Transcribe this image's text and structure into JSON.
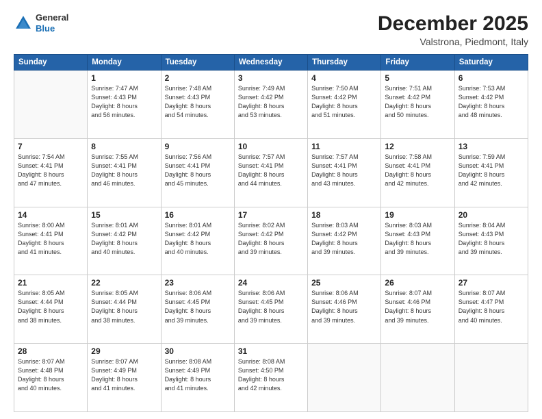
{
  "header": {
    "logo_line1": "General",
    "logo_line2": "Blue",
    "month_year": "December 2025",
    "location": "Valstrona, Piedmont, Italy"
  },
  "days_of_week": [
    "Sunday",
    "Monday",
    "Tuesday",
    "Wednesday",
    "Thursday",
    "Friday",
    "Saturday"
  ],
  "weeks": [
    [
      {
        "day": "",
        "info": ""
      },
      {
        "day": "1",
        "info": "Sunrise: 7:47 AM\nSunset: 4:43 PM\nDaylight: 8 hours\nand 56 minutes."
      },
      {
        "day": "2",
        "info": "Sunrise: 7:48 AM\nSunset: 4:43 PM\nDaylight: 8 hours\nand 54 minutes."
      },
      {
        "day": "3",
        "info": "Sunrise: 7:49 AM\nSunset: 4:42 PM\nDaylight: 8 hours\nand 53 minutes."
      },
      {
        "day": "4",
        "info": "Sunrise: 7:50 AM\nSunset: 4:42 PM\nDaylight: 8 hours\nand 51 minutes."
      },
      {
        "day": "5",
        "info": "Sunrise: 7:51 AM\nSunset: 4:42 PM\nDaylight: 8 hours\nand 50 minutes."
      },
      {
        "day": "6",
        "info": "Sunrise: 7:53 AM\nSunset: 4:42 PM\nDaylight: 8 hours\nand 48 minutes."
      }
    ],
    [
      {
        "day": "7",
        "info": "Sunrise: 7:54 AM\nSunset: 4:41 PM\nDaylight: 8 hours\nand 47 minutes."
      },
      {
        "day": "8",
        "info": "Sunrise: 7:55 AM\nSunset: 4:41 PM\nDaylight: 8 hours\nand 46 minutes."
      },
      {
        "day": "9",
        "info": "Sunrise: 7:56 AM\nSunset: 4:41 PM\nDaylight: 8 hours\nand 45 minutes."
      },
      {
        "day": "10",
        "info": "Sunrise: 7:57 AM\nSunset: 4:41 PM\nDaylight: 8 hours\nand 44 minutes."
      },
      {
        "day": "11",
        "info": "Sunrise: 7:57 AM\nSunset: 4:41 PM\nDaylight: 8 hours\nand 43 minutes."
      },
      {
        "day": "12",
        "info": "Sunrise: 7:58 AM\nSunset: 4:41 PM\nDaylight: 8 hours\nand 42 minutes."
      },
      {
        "day": "13",
        "info": "Sunrise: 7:59 AM\nSunset: 4:41 PM\nDaylight: 8 hours\nand 42 minutes."
      }
    ],
    [
      {
        "day": "14",
        "info": "Sunrise: 8:00 AM\nSunset: 4:41 PM\nDaylight: 8 hours\nand 41 minutes."
      },
      {
        "day": "15",
        "info": "Sunrise: 8:01 AM\nSunset: 4:42 PM\nDaylight: 8 hours\nand 40 minutes."
      },
      {
        "day": "16",
        "info": "Sunrise: 8:01 AM\nSunset: 4:42 PM\nDaylight: 8 hours\nand 40 minutes."
      },
      {
        "day": "17",
        "info": "Sunrise: 8:02 AM\nSunset: 4:42 PM\nDaylight: 8 hours\nand 39 minutes."
      },
      {
        "day": "18",
        "info": "Sunrise: 8:03 AM\nSunset: 4:42 PM\nDaylight: 8 hours\nand 39 minutes."
      },
      {
        "day": "19",
        "info": "Sunrise: 8:03 AM\nSunset: 4:43 PM\nDaylight: 8 hours\nand 39 minutes."
      },
      {
        "day": "20",
        "info": "Sunrise: 8:04 AM\nSunset: 4:43 PM\nDaylight: 8 hours\nand 39 minutes."
      }
    ],
    [
      {
        "day": "21",
        "info": "Sunrise: 8:05 AM\nSunset: 4:44 PM\nDaylight: 8 hours\nand 38 minutes."
      },
      {
        "day": "22",
        "info": "Sunrise: 8:05 AM\nSunset: 4:44 PM\nDaylight: 8 hours\nand 38 minutes."
      },
      {
        "day": "23",
        "info": "Sunrise: 8:06 AM\nSunset: 4:45 PM\nDaylight: 8 hours\nand 39 minutes."
      },
      {
        "day": "24",
        "info": "Sunrise: 8:06 AM\nSunset: 4:45 PM\nDaylight: 8 hours\nand 39 minutes."
      },
      {
        "day": "25",
        "info": "Sunrise: 8:06 AM\nSunset: 4:46 PM\nDaylight: 8 hours\nand 39 minutes."
      },
      {
        "day": "26",
        "info": "Sunrise: 8:07 AM\nSunset: 4:46 PM\nDaylight: 8 hours\nand 39 minutes."
      },
      {
        "day": "27",
        "info": "Sunrise: 8:07 AM\nSunset: 4:47 PM\nDaylight: 8 hours\nand 40 minutes."
      }
    ],
    [
      {
        "day": "28",
        "info": "Sunrise: 8:07 AM\nSunset: 4:48 PM\nDaylight: 8 hours\nand 40 minutes."
      },
      {
        "day": "29",
        "info": "Sunrise: 8:07 AM\nSunset: 4:49 PM\nDaylight: 8 hours\nand 41 minutes."
      },
      {
        "day": "30",
        "info": "Sunrise: 8:08 AM\nSunset: 4:49 PM\nDaylight: 8 hours\nand 41 minutes."
      },
      {
        "day": "31",
        "info": "Sunrise: 8:08 AM\nSunset: 4:50 PM\nDaylight: 8 hours\nand 42 minutes."
      },
      {
        "day": "",
        "info": ""
      },
      {
        "day": "",
        "info": ""
      },
      {
        "day": "",
        "info": ""
      }
    ]
  ]
}
